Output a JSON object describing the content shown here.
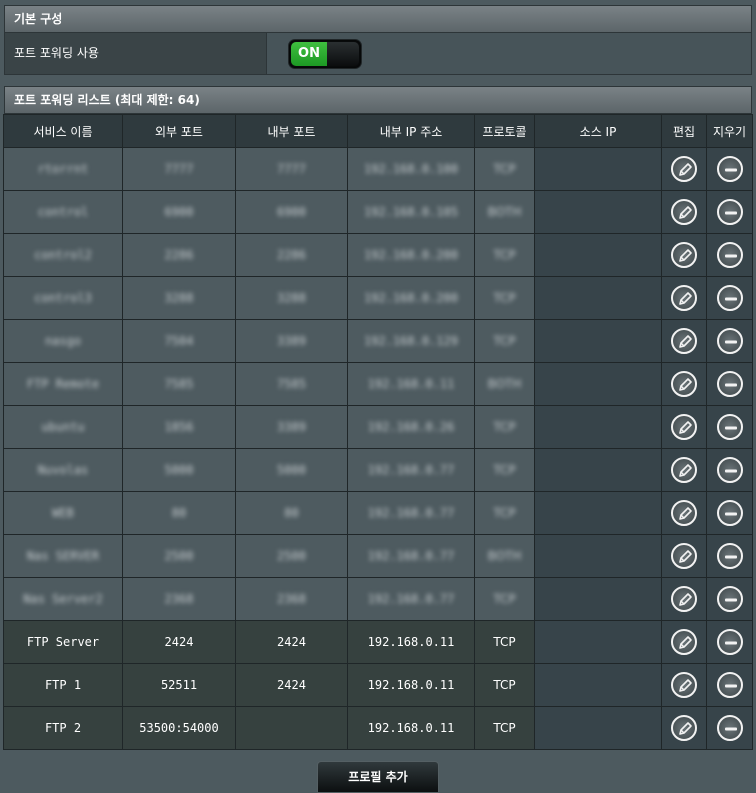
{
  "basic": {
    "title": "기본 구성",
    "enable_label": "포트 포워딩 사용",
    "toggle_value": "ON"
  },
  "list": {
    "title": "포트 포워딩 리스트 (최대 제한: 64)",
    "columns": [
      "서비스 이름",
      "외부 포트",
      "내부 포트",
      "내부 IP 주소",
      "프로토콜",
      "소스 IP",
      "편집",
      "지우기"
    ],
    "rows": [
      {
        "blurred": true,
        "service": "rtorrnt",
        "ext_port": "7777",
        "int_port": "7777",
        "ip": "192.168.0.100",
        "proto": "TCP",
        "src": ""
      },
      {
        "blurred": true,
        "service": "control",
        "ext_port": "6900",
        "int_port": "6900",
        "ip": "192.168.0.105",
        "proto": "BOTH",
        "src": ""
      },
      {
        "blurred": true,
        "service": "control2",
        "ext_port": "2286",
        "int_port": "2286",
        "ip": "192.168.0.200",
        "proto": "TCP",
        "src": ""
      },
      {
        "blurred": true,
        "service": "control3",
        "ext_port": "3288",
        "int_port": "3288",
        "ip": "192.168.0.200",
        "proto": "TCP",
        "src": ""
      },
      {
        "blurred": true,
        "service": "nasgo",
        "ext_port": "7504",
        "int_port": "3389",
        "ip": "192.168.0.129",
        "proto": "TCP",
        "src": ""
      },
      {
        "blurred": true,
        "service": "FTP Remote",
        "ext_port": "7585",
        "int_port": "7585",
        "ip": "192.168.0.11",
        "proto": "BOTH",
        "src": ""
      },
      {
        "blurred": true,
        "service": "ubuntu",
        "ext_port": "1856",
        "int_port": "3389",
        "ip": "192.168.0.26",
        "proto": "TCP",
        "src": ""
      },
      {
        "blurred": true,
        "service": "Nuvolas",
        "ext_port": "5000",
        "int_port": "5000",
        "ip": "192.168.0.77",
        "proto": "TCP",
        "src": ""
      },
      {
        "blurred": true,
        "service": "WEB",
        "ext_port": "80",
        "int_port": "80",
        "ip": "192.168.0.77",
        "proto": "TCP",
        "src": ""
      },
      {
        "blurred": true,
        "service": "Nas SERVER",
        "ext_port": "2500",
        "int_port": "2500",
        "ip": "192.168.0.77",
        "proto": "BOTH",
        "src": ""
      },
      {
        "blurred": true,
        "service": "Nas Server2",
        "ext_port": "2368",
        "int_port": "2368",
        "ip": "192.168.0.77",
        "proto": "TCP",
        "src": ""
      },
      {
        "blurred": false,
        "service": "FTP Server",
        "ext_port": "2424",
        "int_port": "2424",
        "ip": "192.168.0.11",
        "proto": "TCP",
        "src": ""
      },
      {
        "blurred": false,
        "service": "FTP 1",
        "ext_port": "52511",
        "int_port": "2424",
        "ip": "192.168.0.11",
        "proto": "TCP",
        "src": ""
      },
      {
        "blurred": false,
        "service": "FTP 2",
        "ext_port": "53500:54000",
        "int_port": "",
        "ip": "192.168.0.11",
        "proto": "TCP",
        "src": ""
      }
    ]
  },
  "add_profile_label": "프로필 추가",
  "icons": {
    "edit": "pencil-icon",
    "delete": "minus-circle-icon"
  },
  "colors": {
    "toggle_on": "#1d9a24",
    "background": "#4d5a5f",
    "header": "#2f3a3e"
  }
}
